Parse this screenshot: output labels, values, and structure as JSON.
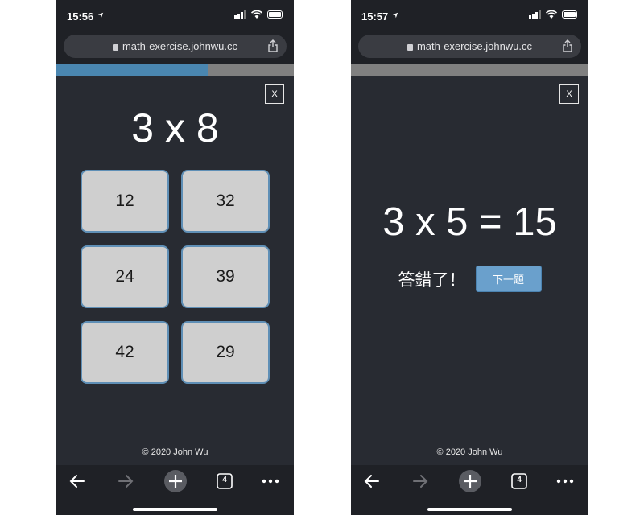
{
  "screens": [
    {
      "status_time": "15:56",
      "url": "math-exercise.johnwu.cc",
      "progress": 0.64,
      "close_label": "X",
      "question": "3 x 8",
      "answers": [
        "12",
        "32",
        "24",
        "39",
        "42",
        "29"
      ],
      "footer": "© 2020 John Wu",
      "tabs_count": "4"
    },
    {
      "status_time": "15:57",
      "url": "math-exercise.johnwu.cc",
      "progress": 0,
      "close_label": "X",
      "result_equation": "3 x 5 = 15",
      "result_text": "答錯了！",
      "next_label": "下一題",
      "footer": "© 2020 John Wu",
      "tabs_count": "4"
    }
  ],
  "colors": {
    "page_background": "#282b32",
    "browser_chrome": "#1f2126",
    "progress_fill": "#4a86b0",
    "progress_track": "#808080",
    "answer_button": "#cfcfcf",
    "answer_border": "#5f8fb6",
    "next_button": "#6aa0cc"
  },
  "icons": [
    "location-arrow-icon",
    "signal-icon",
    "wifi-icon",
    "battery-icon",
    "lock-icon",
    "share-icon",
    "back-arrow-icon",
    "forward-arrow-icon",
    "new-tab-plus-icon",
    "tabs-count-icon",
    "more-options-icon"
  ]
}
